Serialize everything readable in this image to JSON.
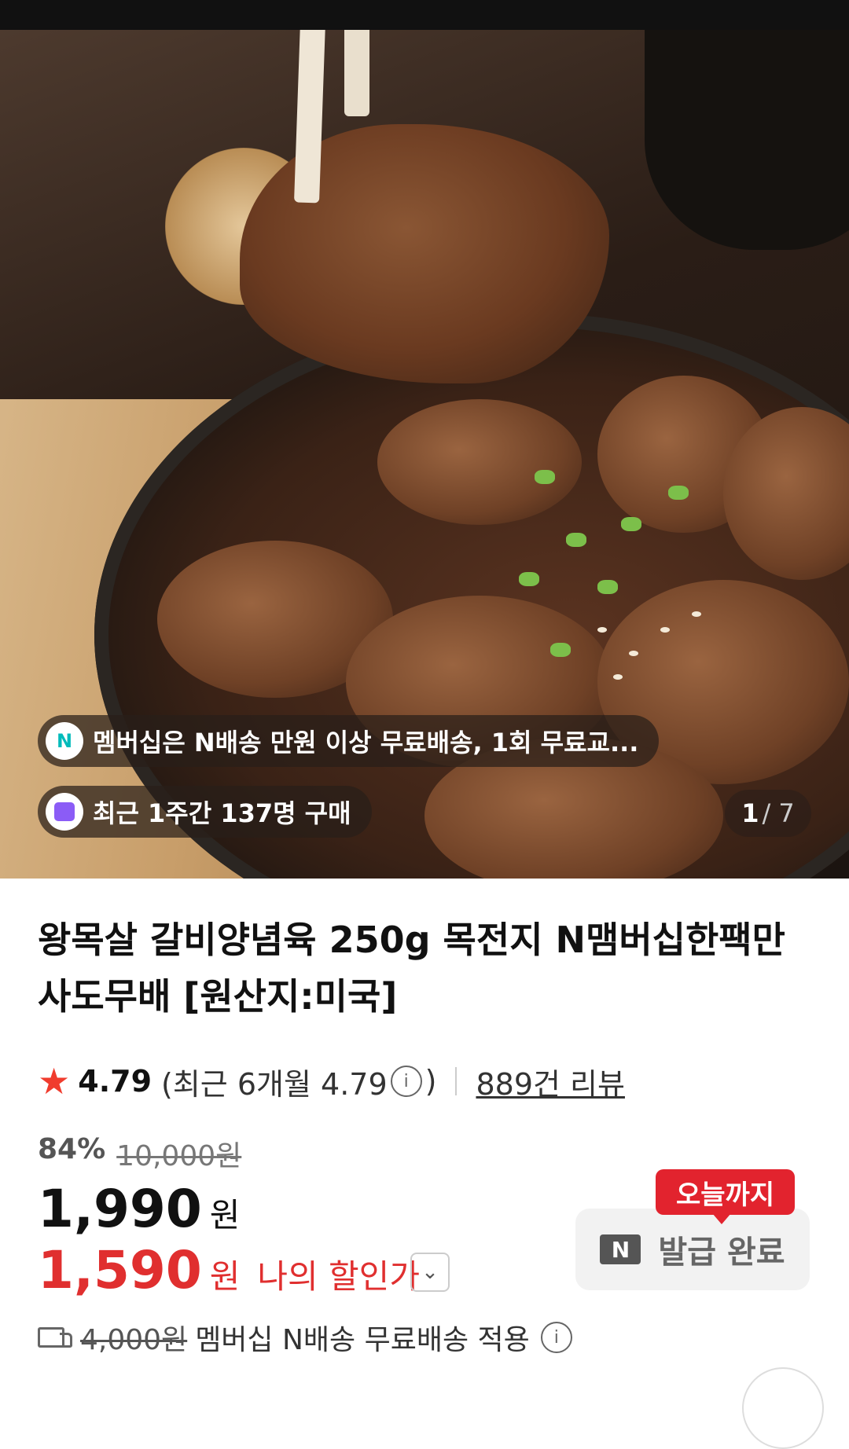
{
  "hero": {
    "pill_membership": "멤버십은 N배송 만원 이상 무료배송, 1회 무료교...",
    "pill_purchases": "최근 1주간 137명 구매",
    "pill_membership_icon": "N",
    "counter_current": "1",
    "counter_total": "/ 7"
  },
  "product": {
    "title": "왕목살 갈비양념육 250g 목전지 N맴버십한팩만 사도무배 [원산지:미국]"
  },
  "rating": {
    "score": "4.79",
    "recent": "(최근 6개월 4.79",
    "recent_close": ")",
    "info_icon": "i",
    "reviews": "889건 리뷰"
  },
  "price": {
    "discount_pct": "84%",
    "original": "10,000원",
    "sale": "1,990",
    "won": "원",
    "my_price": "1,590",
    "my_won": "원",
    "my_label": "나의 할인가"
  },
  "coupon": {
    "badge": "오늘까지",
    "logo": "N",
    "status": "발급 완료"
  },
  "shipping": {
    "original_fee": "4,000원",
    "text": "멤버십 N배송 무료배송 적용",
    "info_icon": "i"
  }
}
